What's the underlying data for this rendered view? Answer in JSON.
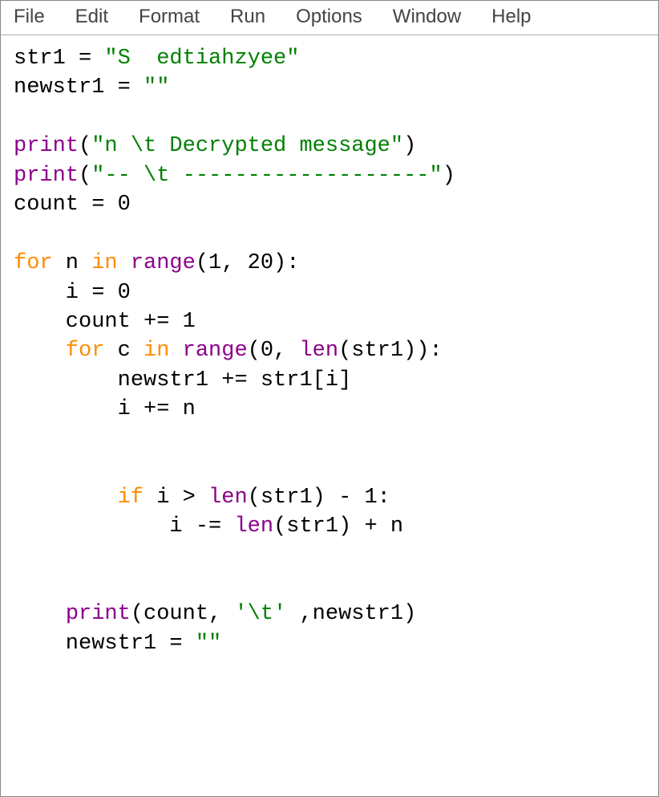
{
  "menu": {
    "file": "File",
    "edit": "Edit",
    "format": "Format",
    "run": "Run",
    "options": "Options",
    "window": "Window",
    "help": "Help"
  },
  "code": {
    "l1a": "str1 = ",
    "l1b": "\"S  edtiahzyee\"",
    "l2a": "newstr1 = ",
    "l2b": "\"\"",
    "l4a": "print",
    "l4b": "(",
    "l4c": "\"n \\t Decrypted message\"",
    "l4d": ")",
    "l5a": "print",
    "l5b": "(",
    "l5c": "\"-- \\t -------------------\"",
    "l5d": ")",
    "l6": "count = 0",
    "l8a": "for",
    "l8b": " n ",
    "l8c": "in",
    "l8d": " ",
    "l8e": "range",
    "l8f": "(1, 20):",
    "l9": "    i = 0",
    "l10": "    count += 1",
    "l11a": "    ",
    "l11b": "for",
    "l11c": " c ",
    "l11d": "in",
    "l11e": " ",
    "l11f": "range",
    "l11g": "(0, ",
    "l11h": "len",
    "l11i": "(str1)):",
    "l12": "        newstr1 += str1[i]",
    "l13": "        i += n",
    "l16a": "        ",
    "l16b": "if",
    "l16c": " i > ",
    "l16d": "len",
    "l16e": "(str1) - 1:",
    "l17a": "            i -= ",
    "l17b": "len",
    "l17c": "(str1) + n",
    "l20a": "    ",
    "l20b": "print",
    "l20c": "(count, ",
    "l20d": "'\\t'",
    "l20e": " ,newstr1)",
    "l21a": "    newstr1 = ",
    "l21b": "\"\""
  }
}
